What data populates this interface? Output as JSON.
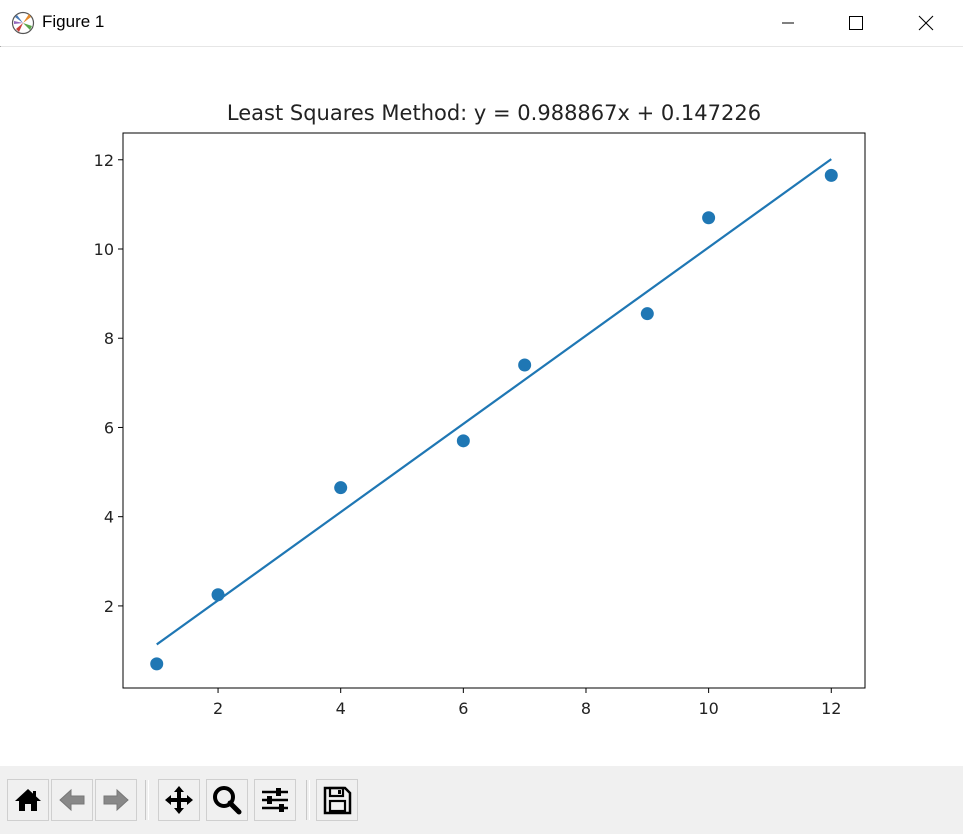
{
  "window": {
    "title": "Figure 1"
  },
  "toolbar": {
    "buttons": [
      "home-icon",
      "back-icon",
      "forward-icon",
      "pan-icon",
      "zoom-icon",
      "configure-subplots-icon",
      "save-icon"
    ]
  },
  "colors": {
    "series": "#1f77b4",
    "toolbar_bg": "#f0f0f0"
  },
  "chart_data": {
    "type": "scatter",
    "title": "Least Squares Method: y = 0.988867x + 0.147226",
    "xlabel": "",
    "ylabel": "",
    "xlim": [
      0.45,
      12.55
    ],
    "ylim": [
      0.16,
      12.6
    ],
    "x_ticks": [
      2,
      4,
      6,
      8,
      10,
      12
    ],
    "y_ticks": [
      2,
      4,
      6,
      8,
      10,
      12
    ],
    "grid": false,
    "series": [
      {
        "kind": "scatter",
        "x": [
          1,
          2,
          4,
          6,
          7,
          9,
          10,
          12
        ],
        "y": [
          0.7,
          2.25,
          4.65,
          5.7,
          7.4,
          8.55,
          10.7,
          11.65
        ]
      },
      {
        "kind": "line",
        "slope": 0.988867,
        "intercept": 0.147226,
        "x": [
          1,
          12
        ]
      }
    ]
  }
}
